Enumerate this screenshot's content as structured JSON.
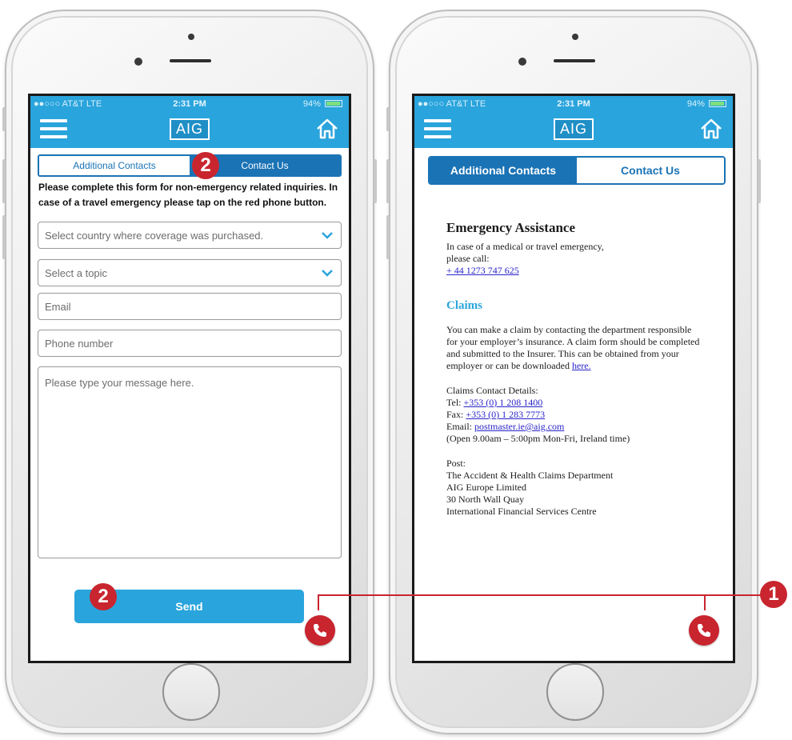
{
  "status_bar": {
    "carrier": "●●○○○ AT&T  LTE",
    "time": "2:31 PM",
    "battery": "94%"
  },
  "header": {
    "logo": "AIG",
    "menu_icon": "hamburger-menu-icon",
    "home_icon": "home-icon"
  },
  "tabs": {
    "additional_contacts": "Additional Contacts",
    "contact_us": "Contact Us"
  },
  "left_screen": {
    "active_tab": "contact_us",
    "intro": "Please complete this form for non-emergency related inquiries. In case of a travel emergency please tap on the red phone button.",
    "country_placeholder": "Select country where coverage was purchased.",
    "topic_placeholder": "Select a topic",
    "email_placeholder": "Email",
    "phone_placeholder": "Phone number",
    "message_placeholder": "Please type your message here.",
    "send_label": "Send"
  },
  "right_screen": {
    "active_tab": "additional_contacts",
    "emergency_title": "Emergency Assistance",
    "emergency_text_1": "In case of a medical or travel emergency,",
    "emergency_text_2": "please call:",
    "emergency_phone": "+ 44 1273 747 625",
    "claims_title": "Claims",
    "claims_p1": "You can make a claim by contacting the department responsible for your employer’s insurance. A claim form should be completed and submitted to the Insurer. This can be obtained from your employer or can be downloaded",
    "claims_link": "here.",
    "contact_details_label": "Claims Contact Details:",
    "tel_label": "Tel:",
    "tel": "+353 (0) 1 208 1400",
    "fax_label": "Fax:",
    "fax": "+353 (0) 1 283 7773",
    "email_label": "Email:",
    "email": "postmaster.ie@aig.com",
    "hours": "(Open 9.00am – 5:00pm Mon-Fri, Ireland time)",
    "post_label": "Post:",
    "post_line_1": "The Accident & Health Claims Department",
    "post_line_2": "AIG Europe Limited",
    "post_line_3": "30 North Wall Quay",
    "post_line_4": "International Financial Services Centre"
  },
  "callouts": {
    "one": "1",
    "two": "2"
  },
  "colors": {
    "header_blue": "#2aa4dc",
    "tab_blue": "#1a73b5",
    "emergency_red": "#c9252f"
  }
}
